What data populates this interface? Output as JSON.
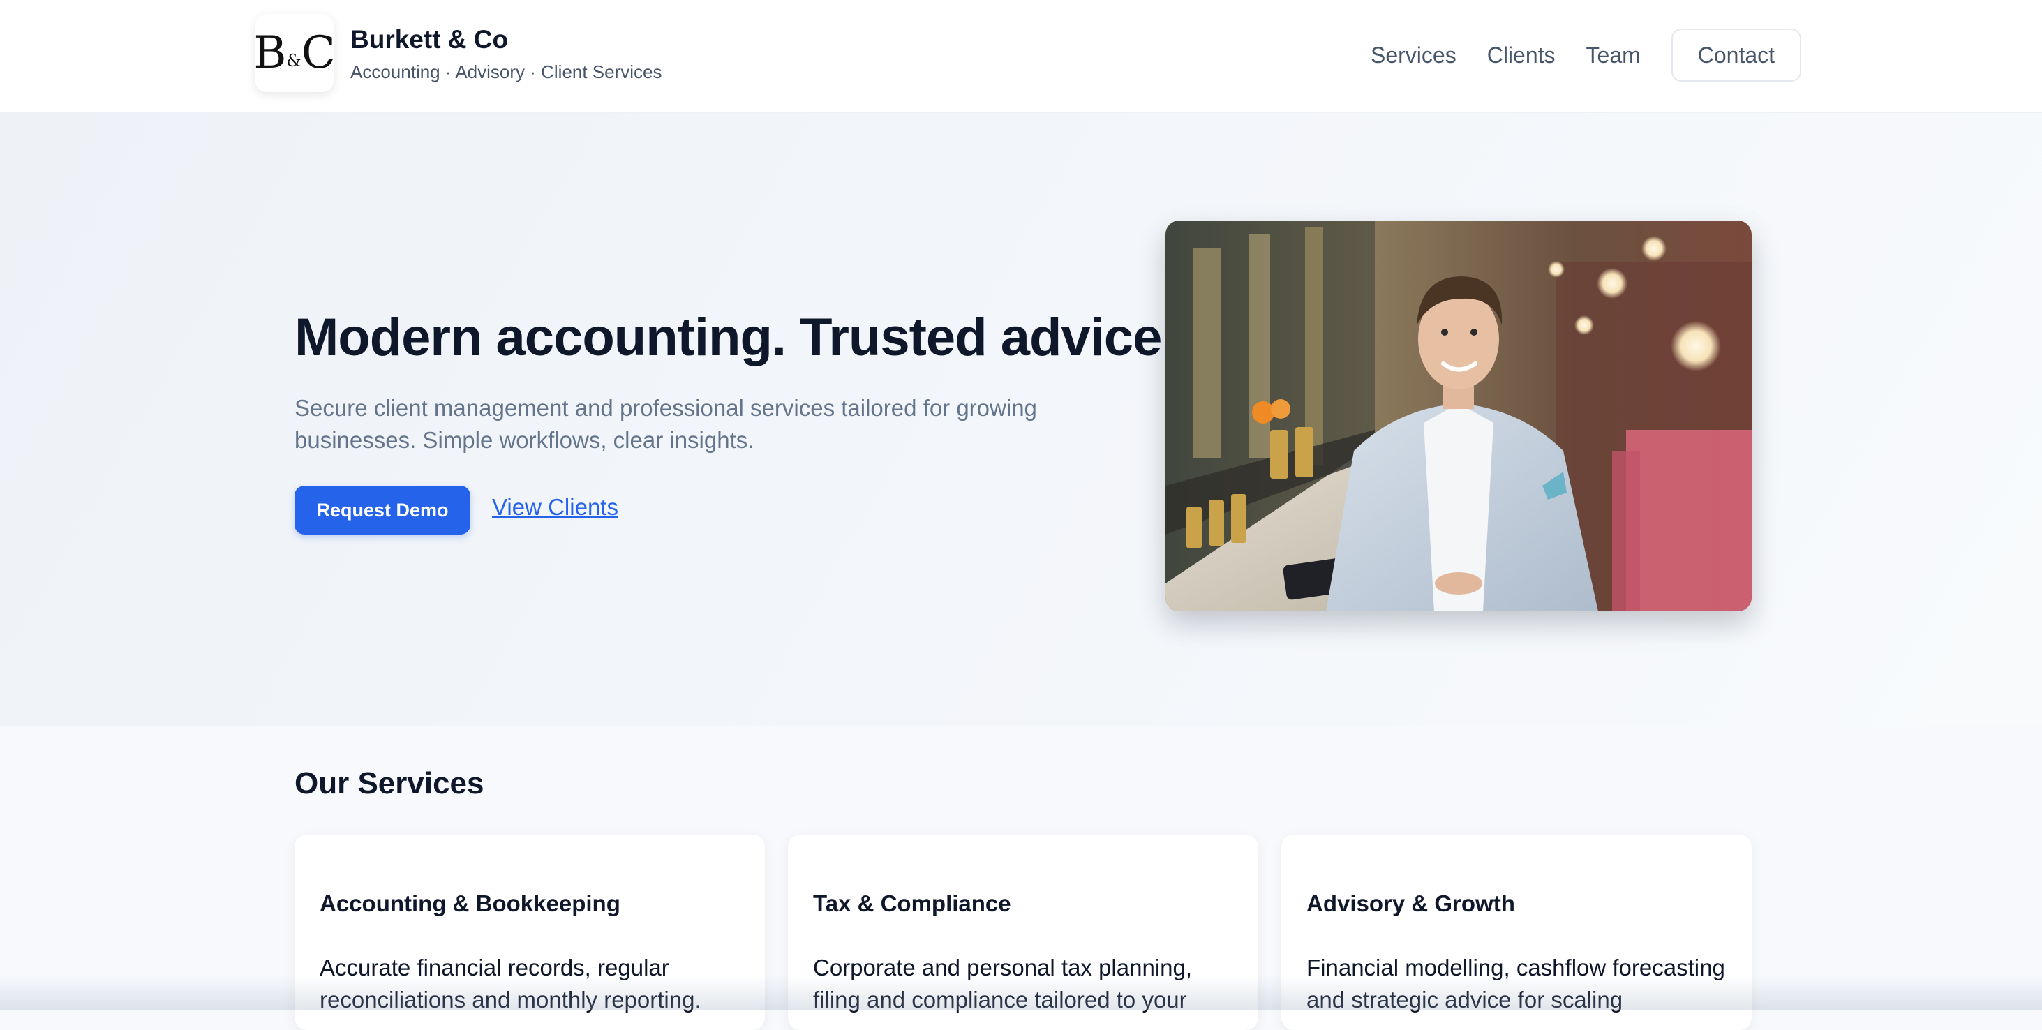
{
  "brand": {
    "logo_letter_1": "B",
    "logo_amp": "&",
    "logo_letter_2": "C",
    "name": "Burkett & Co",
    "tagline": "Accounting · Advisory · Client Services"
  },
  "nav": {
    "items": [
      "Services",
      "Clients",
      "Team"
    ],
    "contact_label": "Contact"
  },
  "hero": {
    "title": "Modern accounting. Trusted advice.",
    "subtitle": "Secure client management and professional services tailored for growing businesses. Simple workflows, clear insights.",
    "primary_cta": "Request Demo",
    "secondary_cta": "View Clients"
  },
  "services": {
    "heading": "Our Services",
    "cards": [
      {
        "title": "Accounting & Bookkeeping",
        "text": "Accurate financial records, regular reconciliations and monthly reporting."
      },
      {
        "title": "Tax & Compliance",
        "text": "Corporate and personal tax planning, filing and compliance tailored to your"
      },
      {
        "title": "Advisory & Growth",
        "text": "Financial modelling, cashflow forecasting and strategic advice for scaling"
      }
    ]
  },
  "colors": {
    "accent": "#2563eb",
    "heading": "#0f172a",
    "muted": "#64748b",
    "nav_text": "#475569"
  }
}
